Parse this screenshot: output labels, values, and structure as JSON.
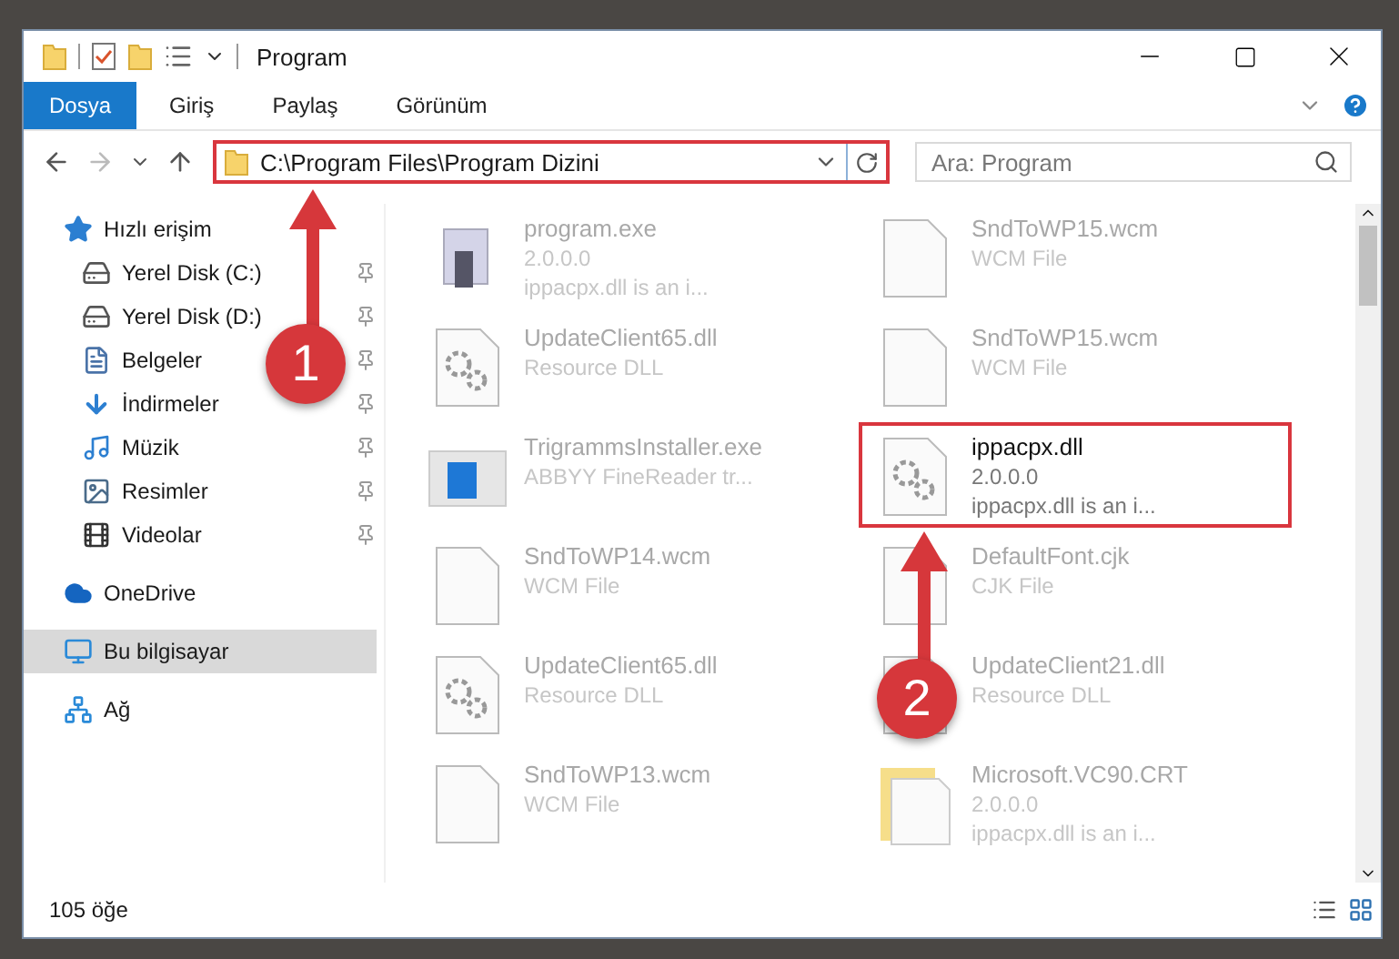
{
  "window": {
    "title": "Program"
  },
  "ribbon_tabs": [
    {
      "label": "Dosya",
      "selected": true
    },
    {
      "label": "Giriş",
      "selected": false
    },
    {
      "label": "Paylaş",
      "selected": false
    },
    {
      "label": "Görünüm",
      "selected": false
    }
  ],
  "address_bar": {
    "path": "C:\\Program Files\\Program Dizini",
    "highlighted": true
  },
  "search": {
    "placeholder": "Ara: Program"
  },
  "nav_pane": {
    "items": [
      {
        "label": "Hızlı erişim",
        "kind": "star",
        "selected": false,
        "children": [
          {
            "label": "Yerel Disk (C:)",
            "kind": "disk",
            "selected": false,
            "pinned": true
          },
          {
            "label": "Yerel Disk (D:)",
            "kind": "disk",
            "selected": false,
            "pinned": true
          },
          {
            "label": "Belgeler",
            "kind": "docs",
            "selected": false,
            "pinned": true
          },
          {
            "label": "İndirmeler",
            "kind": "download",
            "selected": false,
            "pinned": true
          },
          {
            "label": "Müzik",
            "kind": "music",
            "selected": false,
            "pinned": true
          },
          {
            "label": "Resimler",
            "kind": "pictures",
            "selected": false,
            "pinned": true
          },
          {
            "label": "Videolar",
            "kind": "videos",
            "selected": false,
            "pinned": true
          }
        ]
      },
      {
        "label": "OneDrive",
        "kind": "cloud",
        "selected": false
      },
      {
        "label": "Bu bilgisayar",
        "kind": "pc",
        "selected": true
      },
      {
        "label": "Ağ",
        "kind": "network",
        "selected": false
      }
    ]
  },
  "files": [
    {
      "name": "program.exe",
      "lines": [
        "2.0.0.0",
        "ippacpx.dll is an i..."
      ],
      "kind": "exe",
      "highlighted": false
    },
    {
      "name": "SndToWP15.wcm",
      "lines": [
        "WCM File"
      ],
      "kind": "page",
      "highlighted": false
    },
    {
      "name": "UpdateClient65.dll",
      "lines": [
        "Resource DLL"
      ],
      "kind": "dll",
      "highlighted": false
    },
    {
      "name": "SndToWP15.wcm",
      "lines": [
        "WCM File"
      ],
      "kind": "page",
      "highlighted": false
    },
    {
      "name": "TrigrammsInstaller.exe",
      "lines": [
        "ABBYY FineReader tr..."
      ],
      "kind": "installer",
      "highlighted": false
    },
    {
      "name": "ippacpx.dll",
      "lines": [
        "2.0.0.0",
        "ippacpx.dll is an i..."
      ],
      "kind": "dll",
      "highlighted": true
    },
    {
      "name": "SndToWP14.wcm",
      "lines": [
        "WCM File"
      ],
      "kind": "page",
      "highlighted": false
    },
    {
      "name": "DefaultFont.cjk",
      "lines": [
        "CJK File"
      ],
      "kind": "page",
      "highlighted": false
    },
    {
      "name": "UpdateClient65.dll",
      "lines": [
        "Resource DLL"
      ],
      "kind": "dll",
      "highlighted": false
    },
    {
      "name": "UpdateClient21.dll",
      "lines": [
        "Resource DLL"
      ],
      "kind": "dll",
      "highlighted": false
    },
    {
      "name": "SndToWP13.wcm",
      "lines": [
        "WCM File"
      ],
      "kind": "page",
      "highlighted": false
    },
    {
      "name": "Microsoft.VC90.CRT",
      "lines": [
        "2.0.0.0",
        "ippacpx.dll is an i..."
      ],
      "kind": "package",
      "highlighted": false
    }
  ],
  "annotations": [
    {
      "label": "1"
    },
    {
      "label": "2"
    }
  ],
  "status_bar": {
    "item_count": "105 öğe"
  }
}
